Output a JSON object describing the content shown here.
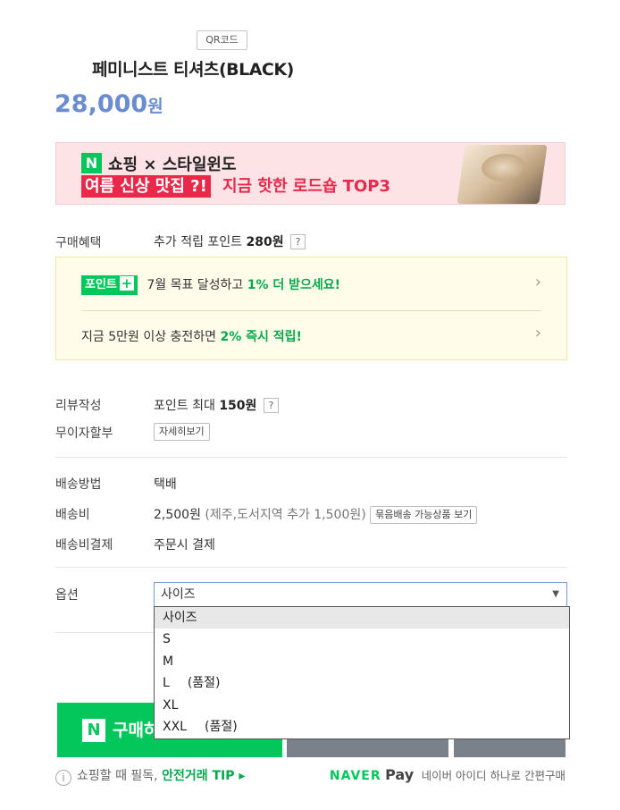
{
  "header": {
    "qr_label": "QR코드",
    "product_title": "페미니스트 티셔츠(BLACK)",
    "price_number": "28,000",
    "price_unit": "원"
  },
  "banner": {
    "logo": "N",
    "line1": "쇼핑 × 스타일윈도",
    "tag": "여름 신상 맛집 ?!",
    "line2": "지금 핫한 로드숍 TOP3"
  },
  "benefit": {
    "label": "구매혜택",
    "prefix": "추가 적립 포인트",
    "amount": "280원",
    "help": "?"
  },
  "point_box": {
    "badge": "포인트",
    "badge_plus": "+",
    "row1_text": "7월 목표 달성하고",
    "row1_highlight": "1% 더 받으세요!",
    "row2_text": "지금 5만원 이상 충전하면",
    "row2_highlight": "2% 즉시 적립!",
    "chevron": "›"
  },
  "review": {
    "label": "리뷰작성",
    "prefix": "포인트 최대",
    "amount": "150원",
    "help": "?"
  },
  "installment": {
    "label": "무이자할부",
    "button": "자세히보기"
  },
  "shipping": {
    "method_label": "배송방법",
    "method_value": "택배",
    "fee_label": "배송비",
    "fee_value": "2,500원",
    "fee_extra": "(제주,도서지역 추가 1,500원)",
    "bundle_button": "묶음배송 가능상품 보기",
    "pay_label": "배송비결제",
    "pay_value": "주문시 결제"
  },
  "option": {
    "label": "옵션",
    "selected": "사이즈",
    "arrow": "▼",
    "items": [
      {
        "name": "사이즈",
        "note": ""
      },
      {
        "name": "S",
        "note": ""
      },
      {
        "name": "M",
        "note": ""
      },
      {
        "name": "L",
        "note": "(품절)"
      },
      {
        "name": "XL",
        "note": ""
      },
      {
        "name": "XXL",
        "note": "(품절)"
      }
    ]
  },
  "buy": {
    "logo": "N",
    "label": "구매하기"
  },
  "footer": {
    "info_icon": "i",
    "notice": "쇼핑할 때 필독,",
    "tip": "안전거래 TIP ▸",
    "brand": "NAVER",
    "pay": "Pay",
    "desc": "네이버 아이디 하나로 간편구매"
  },
  "colors": {
    "naver_green": "#03c75a",
    "price_blue": "#6b8cd0",
    "banner_pink": "#fde3e6",
    "banner_red": "#e8294a",
    "button_gray": "#7b818b"
  }
}
